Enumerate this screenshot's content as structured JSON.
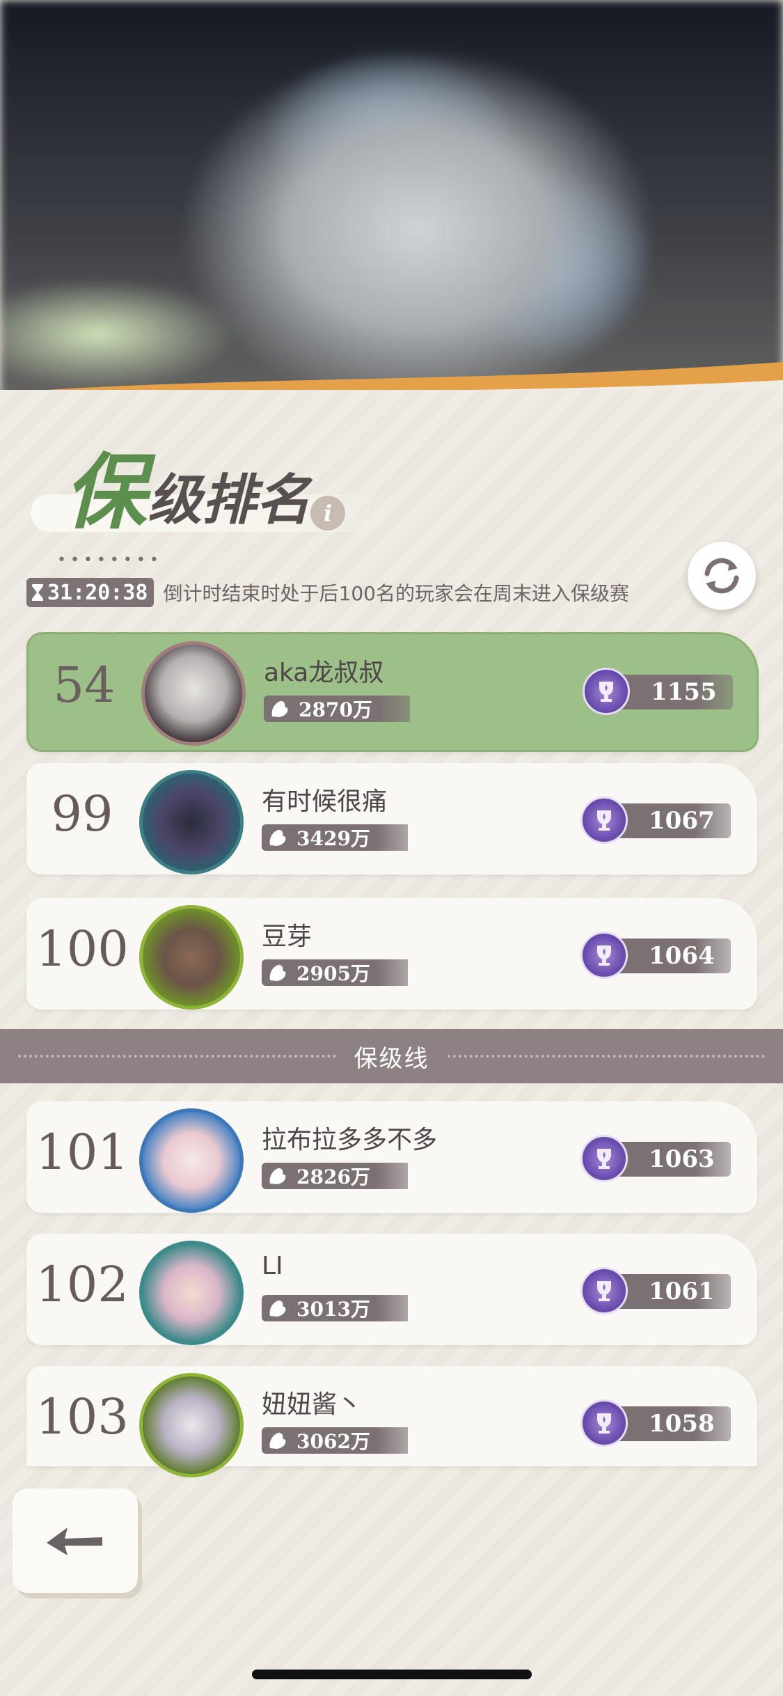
{
  "header": {
    "title_first": "保",
    "title_rest": "级排名",
    "info_icon": "info-icon",
    "timer": "31:20:38",
    "timer_note": "倒计时结束时处于后100名的玩家会在周末进入保级赛",
    "refresh_icon": "refresh-icon"
  },
  "rows": [
    {
      "rank": "54",
      "name": "aka龙叔叔",
      "power": "2870万",
      "trophies": "1155",
      "highlight": true
    },
    {
      "rank": "99",
      "name": "有时候很痛",
      "power": "3429万",
      "trophies": "1067"
    },
    {
      "rank": "100",
      "name": "豆芽",
      "power": "2905万",
      "trophies": "1064"
    }
  ],
  "divider": {
    "label": "保级线"
  },
  "rows_below": [
    {
      "rank": "101",
      "name": "拉布拉多多不多",
      "power": "2826万",
      "trophies": "1063"
    },
    {
      "rank": "102",
      "name": "LI",
      "power": "3013万",
      "trophies": "1061"
    },
    {
      "rank": "103",
      "name": "妞妞酱丶",
      "power": "3062万",
      "trophies": "1058"
    }
  ],
  "back_icon": "back-arrow-icon",
  "colors": {
    "accent_green": "#9dbf88",
    "title_green": "#5c8f4e",
    "muted": "#7b7072",
    "trophy_purple": "#6c4fb0"
  }
}
